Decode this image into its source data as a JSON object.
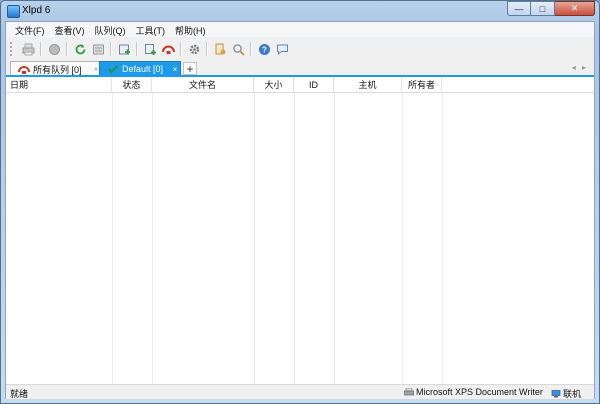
{
  "window": {
    "title": "Xlpd 6",
    "minimize": "—",
    "maximize": "□",
    "close": "✕"
  },
  "menu": [
    {
      "label": "文件(F)"
    },
    {
      "label": "查看(V)"
    },
    {
      "label": "队列(Q)"
    },
    {
      "label": "工具(T)"
    },
    {
      "label": "帮助(H)"
    }
  ],
  "toolbar": {
    "icons": [
      "print-icon",
      "stop-icon",
      "refresh-icon",
      "queue-icon",
      "add-queue-icon",
      "printer-add-icon",
      "printer-icon",
      "settings-icon",
      "user-icon",
      "search-icon",
      "help-icon",
      "message-icon"
    ]
  },
  "tabs": [
    {
      "label": "所有队列 [0]",
      "close": "×",
      "active": false
    },
    {
      "label": "Default [0]",
      "close": "×",
      "active": true
    }
  ],
  "tab_add": "+",
  "tab_nav": "◂ ▸",
  "table": {
    "columns": [
      "日期",
      "状态",
      "文件名",
      "大小",
      "ID",
      "主机",
      "所有者"
    ],
    "rows": []
  },
  "status": {
    "left": "就绪",
    "printer": "Microsoft XPS Document Writer",
    "online": "联机"
  },
  "colors": {
    "accent": "#1e9be8",
    "titlebar": "#b9d1ea",
    "close": "#c8513d"
  }
}
